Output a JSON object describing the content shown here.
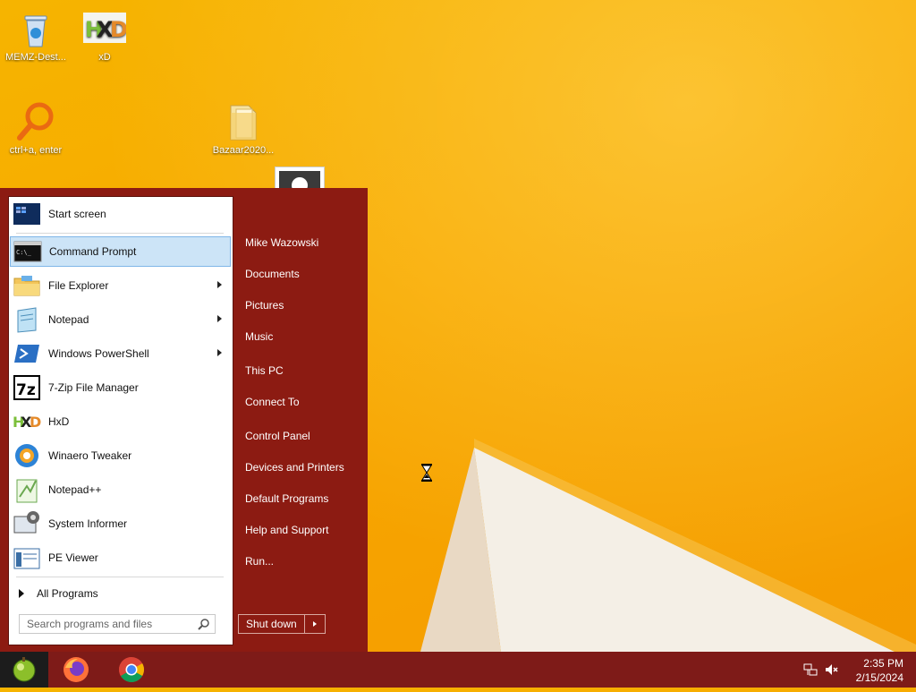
{
  "desktop": {
    "icons": [
      {
        "label": "MEMZ-Dest...",
        "icon": "recycle-bin-icon"
      },
      {
        "label": "xD",
        "icon": "hxd-icon"
      },
      {
        "label": "ctrl+a, enter",
        "icon": "magnifier-icon"
      },
      {
        "label": "Bazaar2020...",
        "icon": "folder-icon"
      }
    ]
  },
  "start_menu": {
    "programs": [
      {
        "label": "Start screen",
        "icon": "start-screen-icon"
      },
      {
        "label": "Command Prompt",
        "icon": "command-prompt-icon",
        "selected": true
      },
      {
        "label": "File Explorer",
        "icon": "file-explorer-icon",
        "submenu": true
      },
      {
        "label": "Notepad",
        "icon": "notepad-icon",
        "submenu": true
      },
      {
        "label": "Windows PowerShell",
        "icon": "powershell-icon",
        "submenu": true
      },
      {
        "label": "7-Zip File Manager",
        "icon": "7zip-icon"
      },
      {
        "label": "HxD",
        "icon": "hxd-icon"
      },
      {
        "label": "Winaero Tweaker",
        "icon": "winaero-icon"
      },
      {
        "label": "Notepad++",
        "icon": "notepadpp-icon"
      },
      {
        "label": "System Informer",
        "icon": "system-informer-icon"
      },
      {
        "label": "PE Viewer",
        "icon": "pe-viewer-icon"
      }
    ],
    "all_programs": "All Programs",
    "search_placeholder": "Search programs and files",
    "right_links": [
      "Mike Wazowski",
      "Documents",
      "Pictures",
      "Music",
      "This PC",
      "Connect To",
      "Control Panel",
      "Devices and Printers",
      "Default Programs",
      "Help and Support",
      "Run..."
    ],
    "shutdown_label": "Shut down"
  },
  "taskbar": {
    "apps": [
      {
        "icon": "firefox-icon"
      },
      {
        "icon": "chrome-icon"
      }
    ],
    "tray": [
      "network-icon",
      "volume-muted-icon"
    ],
    "time": "2:35 PM",
    "date": "2/15/2024"
  },
  "colors": {
    "start_menu_bg": "#8c1b12",
    "taskbar_bg": "#7e1b18",
    "selection_bg": "#cce4f7",
    "wallpaper": "#f6b400"
  }
}
